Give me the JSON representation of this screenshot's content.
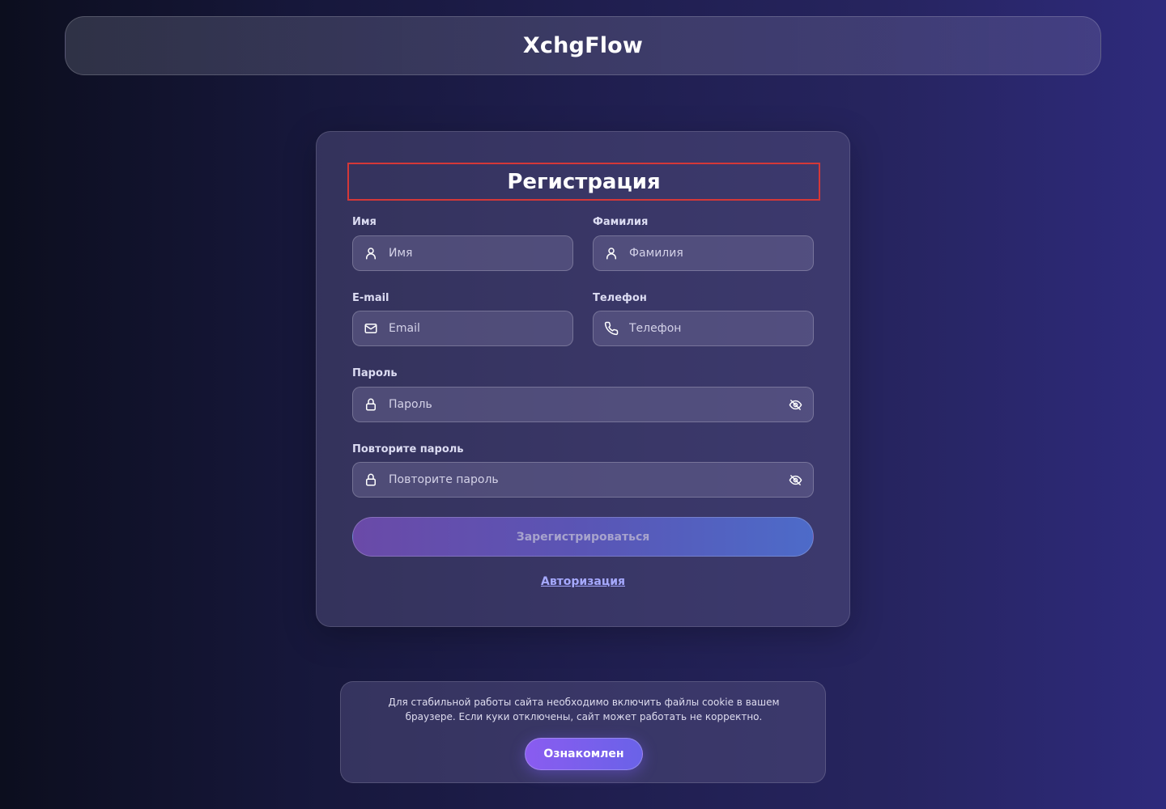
{
  "header": {
    "brand": "XchgFlow"
  },
  "form": {
    "title": "Регистрация",
    "first_name": {
      "label": "Имя",
      "placeholder": "Имя",
      "icon": "user-icon"
    },
    "last_name": {
      "label": "Фамилия",
      "placeholder": "Фамилия",
      "icon": "user-icon"
    },
    "email": {
      "label": "E-mail",
      "placeholder": "Email",
      "icon": "mail-icon"
    },
    "phone": {
      "label": "Телефон",
      "placeholder": "Телефон",
      "icon": "phone-icon"
    },
    "password": {
      "label": "Пароль",
      "placeholder": "Пароль",
      "icon": "lock-icon",
      "toggle_icon": "eye-off-icon"
    },
    "password_repeat": {
      "label": "Повторите пароль",
      "placeholder": "Повторите пароль",
      "icon": "lock-icon",
      "toggle_icon": "eye-off-icon"
    },
    "submit_label": "Зарегистрироваться",
    "auth_link": "Авторизация"
  },
  "cookie": {
    "text": "Для стабильной работы сайта необходимо включить файлы cookie в вашем браузере. Если куки отключены, сайт может работать не корректно.",
    "button_label": "Ознакомлен"
  },
  "colors": {
    "accent": "#8a5cf0",
    "link": "#a6a9ff",
    "title_outline": "#d43838"
  }
}
